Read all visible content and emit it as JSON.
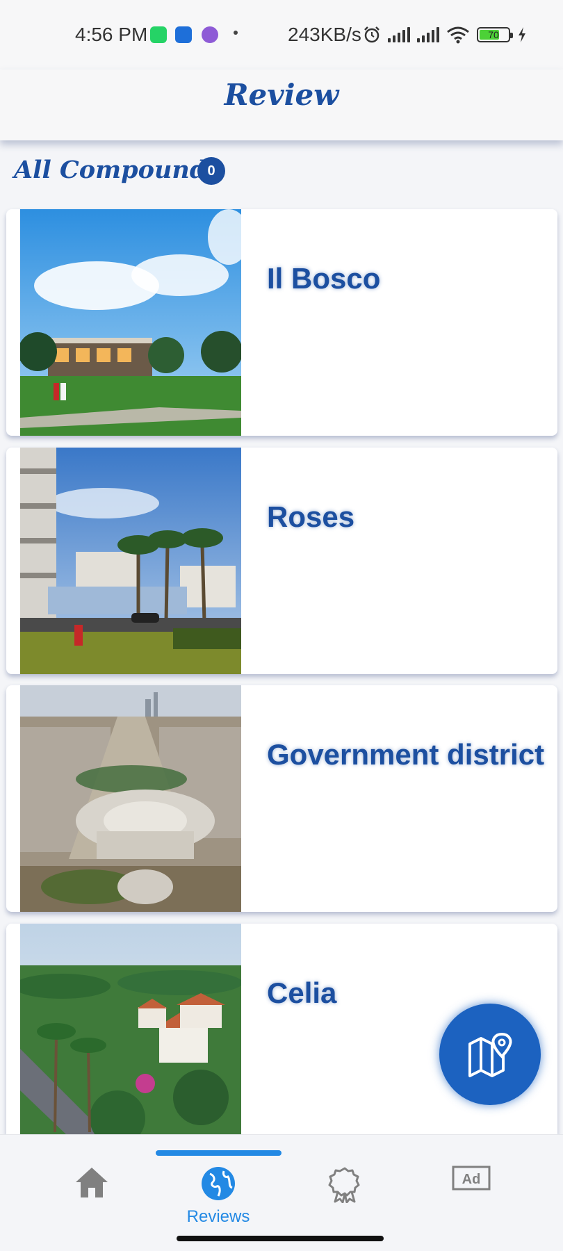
{
  "status_bar": {
    "time": "4:56 PM",
    "network_speed": "243KB/s",
    "battery_level": "70",
    "icons": [
      "whatsapp-icon",
      "message-icon",
      "app-icon",
      "alarm-icon",
      "signal-icon",
      "signal-icon",
      "wifi-icon",
      "battery-icon",
      "charging-icon"
    ]
  },
  "header": {
    "title": "Review"
  },
  "section": {
    "title": "All Compounds",
    "count": "0"
  },
  "compounds": [
    {
      "name": "Il Bosco"
    },
    {
      "name": "Roses"
    },
    {
      "name": "Government district"
    },
    {
      "name": "Celia"
    }
  ],
  "fab": {
    "icon": "map-pin-icon"
  },
  "bottom_nav": {
    "items": [
      {
        "icon": "home-icon",
        "label": ""
      },
      {
        "icon": "globe-icon",
        "label": "Reviews",
        "active": true
      },
      {
        "icon": "award-icon",
        "label": ""
      },
      {
        "icon": "ad-icon",
        "label": "Ad"
      }
    ]
  },
  "colors": {
    "brand": "#1c4fa0",
    "accent": "#2389e4",
    "fab": "#1c62c0"
  }
}
